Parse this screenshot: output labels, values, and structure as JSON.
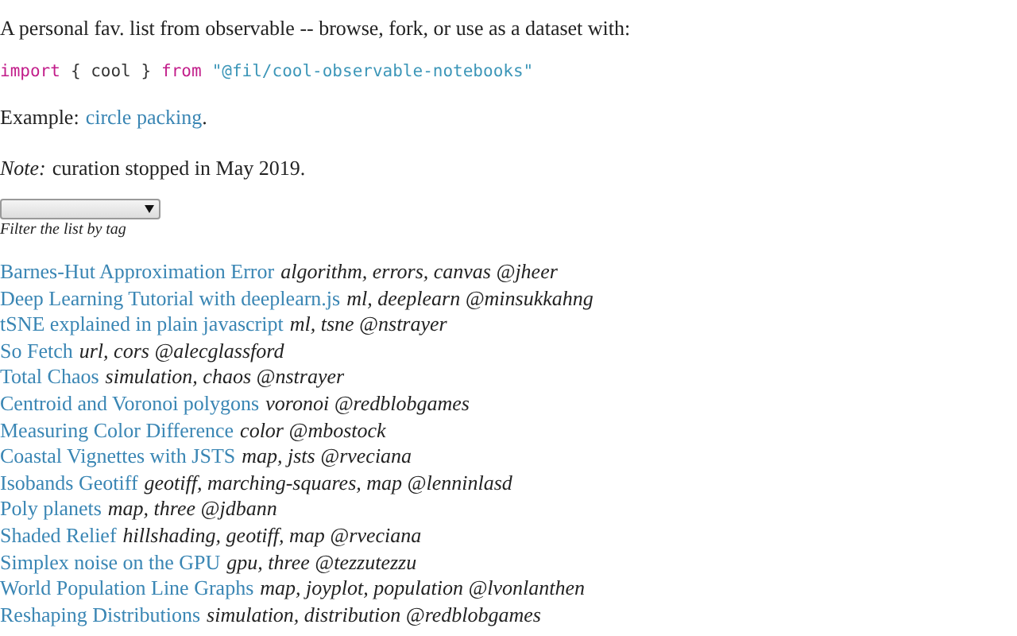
{
  "intro": "A personal fav. list from observable -- browse, fork, or use as a dataset with:",
  "code": [
    {
      "kind": "keyword",
      "text": "import"
    },
    {
      "kind": "plain",
      "text": "{ cool }"
    },
    {
      "kind": "keyword",
      "text": "from"
    },
    {
      "kind": "string",
      "text": "\"@fil/cool-observable-notebooks\""
    }
  ],
  "example": {
    "label": "Example:",
    "link": "circle packing",
    "after": "."
  },
  "note": {
    "label": "Note:",
    "text": "curation stopped in May 2019."
  },
  "filter": {
    "caption": "Filter the list by tag"
  },
  "notebooks": [
    {
      "title": "Barnes-Hut Approximation Error",
      "tags": "algorithm, errors, canvas",
      "author": "@jheer"
    },
    {
      "title": "Deep Learning Tutorial with deeplearn.js",
      "tags": "ml, deeplearn",
      "author": "@minsukkahng"
    },
    {
      "title": "tSNE explained in plain javascript",
      "tags": "ml, tsne",
      "author": "@nstrayer"
    },
    {
      "title": "So Fetch",
      "tags": "url, cors",
      "author": "@alecglassford"
    },
    {
      "title": "Total Chaos",
      "tags": "simulation, chaos",
      "author": "@nstrayer"
    },
    {
      "title": "Centroid and Voronoi polygons",
      "tags": "voronoi",
      "author": "@redblobgames"
    },
    {
      "title": "Measuring Color Difference",
      "tags": "color",
      "author": "@mbostock"
    },
    {
      "title": "Coastal Vignettes with JSTS",
      "tags": "map, jsts",
      "author": "@rveciana"
    },
    {
      "title": "Isobands Geotiff",
      "tags": "geotiff, marching-squares, map",
      "author": "@lenninlasd"
    },
    {
      "title": "Poly planets",
      "tags": "map, three",
      "author": "@jdbann"
    },
    {
      "title": "Shaded Relief",
      "tags": "hillshading, geotiff, map",
      "author": "@rveciana"
    },
    {
      "title": "Simplex noise on the GPU",
      "tags": "gpu, three",
      "author": "@tezzutezzu"
    },
    {
      "title": "World Population Line Graphs",
      "tags": "map, joyplot, population",
      "author": "@lvonlanthen"
    },
    {
      "title": "Reshaping Distributions",
      "tags": "simulation, distribution",
      "author": "@redblobgames"
    }
  ]
}
